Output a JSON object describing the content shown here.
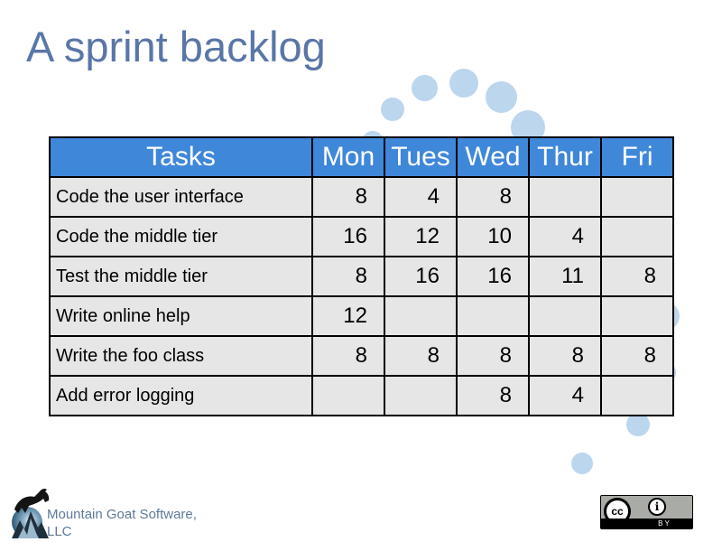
{
  "slide": {
    "title": "A sprint backlog",
    "accent_colors": {
      "title": "#5a76a8",
      "header_bg": "#3f87d9",
      "cell_bg": "#e6e6e6",
      "decor_dots": "#bcd6ee"
    }
  },
  "table": {
    "headers": [
      "Tasks",
      "Mon",
      "Tues",
      "Wed",
      "Thur",
      "Fri"
    ],
    "rows": [
      {
        "task": "Code the user interface",
        "mon": "8",
        "tues": "4",
        "wed": "8",
        "thur": "",
        "fri": ""
      },
      {
        "task": "Code the middle tier",
        "mon": "16",
        "tues": "12",
        "wed": "10",
        "thur": "4",
        "fri": ""
      },
      {
        "task": "Test the middle tier",
        "mon": "8",
        "tues": "16",
        "wed": "16",
        "thur": "11",
        "fri": "8"
      },
      {
        "task": "Write online help",
        "mon": "12",
        "tues": "",
        "wed": "",
        "thur": "",
        "fri": ""
      },
      {
        "task": "Write the foo class",
        "mon": "8",
        "tues": "8",
        "wed": "8",
        "thur": "8",
        "fri": "8"
      },
      {
        "task": "Add error logging",
        "mon": "",
        "tues": "",
        "wed": "8",
        "thur": "4",
        "fri": ""
      }
    ]
  },
  "footer": {
    "company_line1": "Mountain Goat Software,",
    "company_line2": "LLC",
    "license": {
      "cc_label": "cc",
      "by_icon": "i",
      "by_label": "BY"
    }
  },
  "icons": {
    "logo": "mountain-goat-logo-icon",
    "license": "creative-commons-by-icon"
  }
}
